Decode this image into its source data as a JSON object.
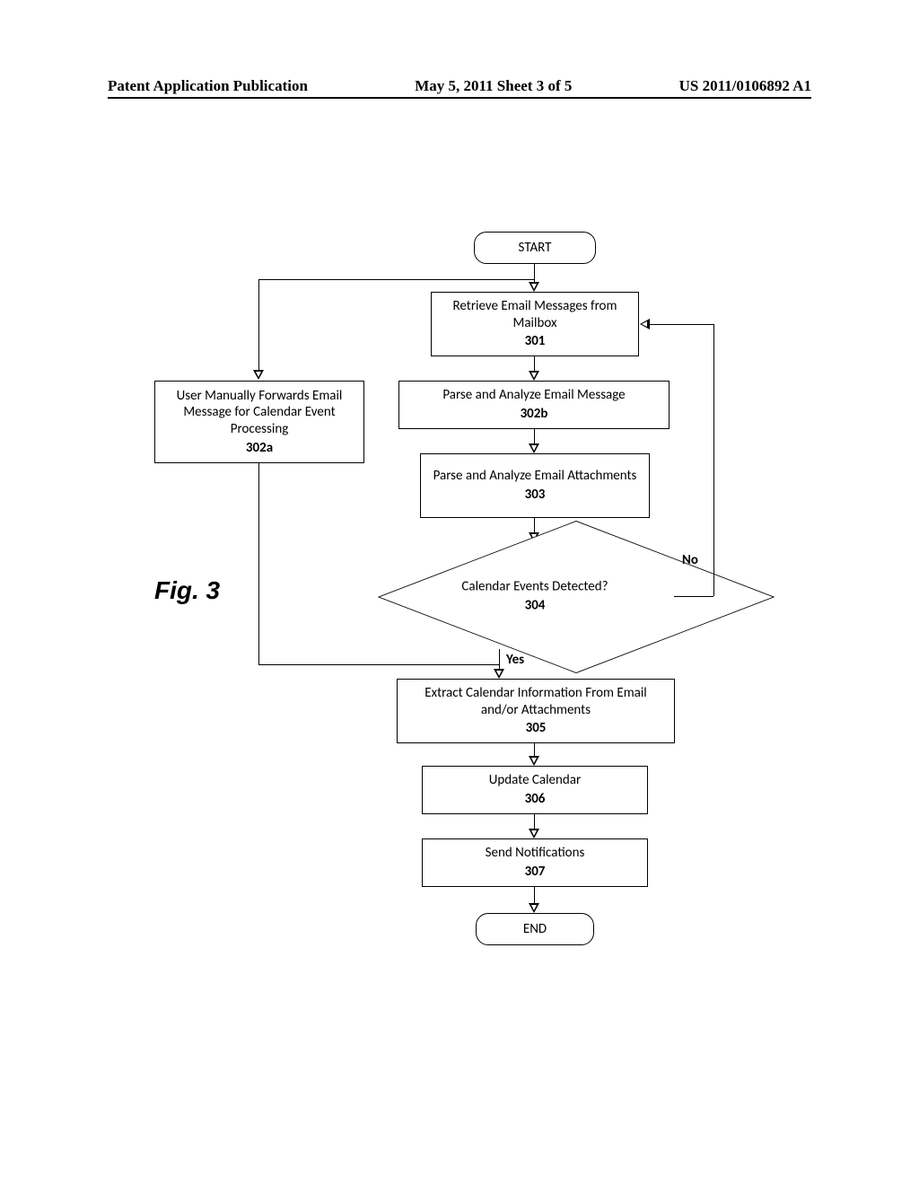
{
  "header": {
    "left": "Patent Application Publication",
    "center": "May 5, 2011  Sheet 3 of 5",
    "right": "US 2011/0106892 A1"
  },
  "figure_label": "Fig. 3",
  "nodes": {
    "start": "START",
    "end": "END",
    "n301": {
      "text": "Retrieve Email Messages from Mailbox",
      "ref": "301"
    },
    "n302a": {
      "text": "User Manually Forwards Email Message for Calendar Event Processing",
      "ref": "302a"
    },
    "n302b": {
      "text": "Parse and Analyze Email Message",
      "ref": "302b"
    },
    "n303": {
      "text": "Parse and Analyze Email Attachments",
      "ref": "303"
    },
    "n304": {
      "text": "Calendar Events Detected?",
      "ref": "304"
    },
    "n305": {
      "text": "Extract Calendar Information From Email and/or Attachments",
      "ref": "305"
    },
    "n306": {
      "text": "Update Calendar",
      "ref": "306"
    },
    "n307": {
      "text": "Send Notifications",
      "ref": "307"
    }
  },
  "decision_labels": {
    "yes": "Yes",
    "no": "No"
  },
  "chart_data": {
    "type": "flowchart",
    "nodes": [
      {
        "id": "start",
        "kind": "terminator",
        "label": "START"
      },
      {
        "id": "301",
        "kind": "process",
        "label": "Retrieve Email Messages from Mailbox"
      },
      {
        "id": "302a",
        "kind": "process",
        "label": "User Manually Forwards Email Message for Calendar Event Processing"
      },
      {
        "id": "302b",
        "kind": "process",
        "label": "Parse and Analyze Email Message"
      },
      {
        "id": "303",
        "kind": "process",
        "label": "Parse and Analyze Email Attachments"
      },
      {
        "id": "304",
        "kind": "decision",
        "label": "Calendar Events Detected?"
      },
      {
        "id": "305",
        "kind": "process",
        "label": "Extract Calendar Information From Email and/or Attachments"
      },
      {
        "id": "306",
        "kind": "process",
        "label": "Update Calendar"
      },
      {
        "id": "307",
        "kind": "process",
        "label": "Send Notifications"
      },
      {
        "id": "end",
        "kind": "terminator",
        "label": "END"
      }
    ],
    "edges": [
      {
        "from": "start",
        "to": "301"
      },
      {
        "from": "301",
        "to": "302b"
      },
      {
        "from": "301",
        "to": "302a"
      },
      {
        "from": "302b",
        "to": "303"
      },
      {
        "from": "302a",
        "to": "303"
      },
      {
        "from": "303",
        "to": "304"
      },
      {
        "from": "304",
        "to": "305",
        "label": "Yes"
      },
      {
        "from": "304",
        "to": "301",
        "label": "No"
      },
      {
        "from": "305",
        "to": "306"
      },
      {
        "from": "306",
        "to": "307"
      },
      {
        "from": "307",
        "to": "end"
      }
    ]
  }
}
